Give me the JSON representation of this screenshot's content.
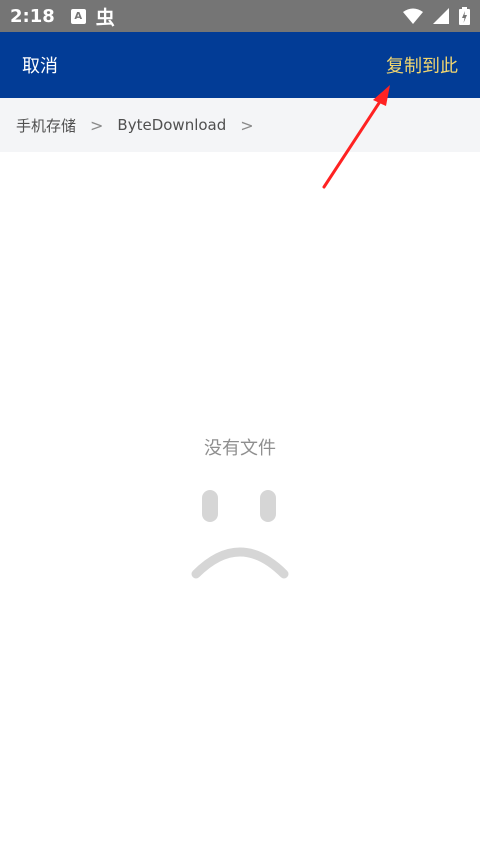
{
  "status_bar": {
    "time": "2:18",
    "app_icon_letter": "A",
    "bug_icon_glyph": "虫",
    "icons": [
      "wifi-icon",
      "signal-icon",
      "battery-icon"
    ]
  },
  "app_bar": {
    "cancel_label": "取消",
    "copy_here_label": "复制到此",
    "background_color": "#023c96",
    "accent_color": "#f2d66f"
  },
  "breadcrumb": {
    "items": [
      "手机存储",
      "ByteDownload"
    ],
    "separator": ">"
  },
  "empty_state": {
    "message": "没有文件",
    "icon": "sad-face-icon"
  },
  "annotation": {
    "icon": "red-arrow-icon",
    "color": "#ff2222"
  }
}
